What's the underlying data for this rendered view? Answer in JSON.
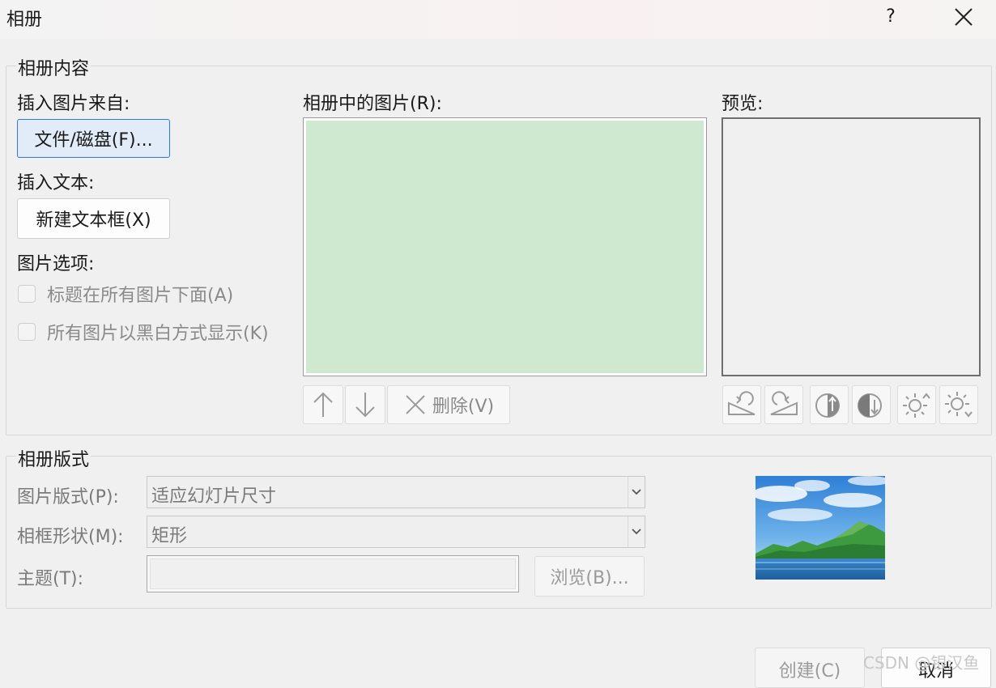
{
  "window": {
    "title": "相册",
    "help_label": "?"
  },
  "content_group": {
    "title": "相册内容",
    "insert_picture_from": "插入图片来自:",
    "file_disk_button": "文件/磁盘(F)...",
    "insert_text": "插入文本:",
    "new_textbox_button": "新建文本框(X)",
    "picture_options": "图片选项:",
    "options": [
      {
        "label": "标题在所有图片下面(A)",
        "checked": false
      },
      {
        "label": "所有图片以黑白方式显示(K)",
        "checked": false
      }
    ],
    "pictures_in_album_label": "相册中的图片(R):",
    "list_items": [],
    "delete_button": "删除(V)",
    "preview_label": "预览:"
  },
  "layout_group": {
    "title": "相册版式",
    "picture_layout_label": "图片版式(P):",
    "picture_layout_value": "适应幻灯片尺寸",
    "frame_shape_label": "相框形状(M):",
    "frame_shape_value": "矩形",
    "theme_label": "主题(T):",
    "theme_value": "",
    "browse_button": "浏览(B)..."
  },
  "footer": {
    "create_button": "创建(C)",
    "cancel_button": "取消",
    "watermark": "CSDN @银汉鱼"
  },
  "colors": {
    "list_fill": "#cfe8d0",
    "focus_border": "#3b79c4"
  }
}
